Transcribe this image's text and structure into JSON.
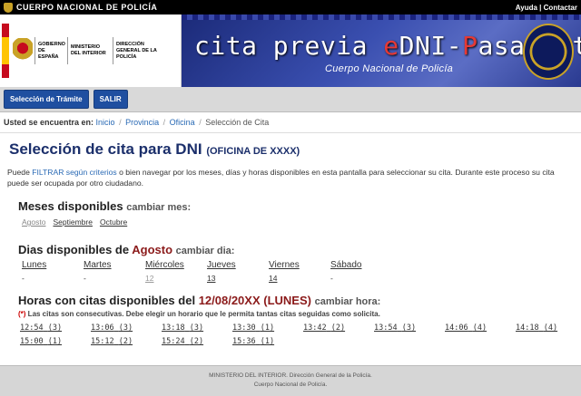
{
  "topbar": {
    "brand": "CUERPO NACIONAL DE POLICÍA",
    "help": "Ayuda",
    "separator": "|",
    "contact": "Contactar"
  },
  "banner": {
    "gov_block1": "GOBIERNO DE ESPAÑA",
    "gov_block2": "MINISTERIO DEL INTERIOR",
    "gov_block3": "DIRECCIÓN GENERAL DE LA POLICÍA",
    "title_part1": "cita previa ",
    "title_e": "e",
    "title_part2": "DNI-",
    "title_p": "P",
    "title_part3": "asaporte",
    "subtitle": "Cuerpo Nacional de Policía"
  },
  "buttons": {
    "select_procedure": "Selección de Trámite",
    "exit": "SALIR"
  },
  "breadcrumb": {
    "prefix": "Usted se encuentra en:",
    "items": [
      "Inicio",
      "Provincia",
      "Oficina"
    ],
    "current": "Selección de Cita"
  },
  "page": {
    "title": "Selección de cita para DNI",
    "office": "(OFICINA DE XXXX)",
    "intro_prefix": "Puede ",
    "intro_filter": "FILTRAR según criterios",
    "intro_rest": " o bien navegar por los meses, días y horas disponibles en esta pantalla para seleccionar su cita. Durante este proceso su cita puede ser ocupada por otro ciudadano."
  },
  "months": {
    "heading": "Meses disponibles",
    "change": "cambiar mes:",
    "items": [
      {
        "label": "Agosto"
      },
      {
        "label": "Septiembre"
      },
      {
        "label": "Octubre"
      }
    ]
  },
  "days": {
    "heading": "Dias disponibles de",
    "month": "Agosto",
    "change": "cambiar dia:",
    "columns": [
      {
        "name": "Lunes",
        "value": "-"
      },
      {
        "name": "Martes",
        "value": "-"
      },
      {
        "name": "Miércoles",
        "value": "12"
      },
      {
        "name": "Jueves",
        "value": "13"
      },
      {
        "name": "Viernes",
        "value": "14"
      },
      {
        "name": "Sábado",
        "value": "-"
      }
    ]
  },
  "hours": {
    "heading": "Horas con citas disponibles del",
    "date": "12/08/20XX (LUNES)",
    "change": "cambiar hora:",
    "note_ast": "(*)",
    "note": " Las citas son consecutivas. Debe elegir un horario que le permita tantas citas seguidas como solicita.",
    "slots": [
      {
        "time": "12:54",
        "count": "(3)"
      },
      {
        "time": "13:06",
        "count": "(3)"
      },
      {
        "time": "13:18",
        "count": "(3)"
      },
      {
        "time": "13:30",
        "count": "(1)"
      },
      {
        "time": "13:42",
        "count": "(2)"
      },
      {
        "time": "13:54",
        "count": "(3)"
      },
      {
        "time": "14:06",
        "count": "(4)"
      },
      {
        "time": "14:18",
        "count": "(4)"
      },
      {
        "time": "15:00",
        "count": "(1)"
      },
      {
        "time": "15:12",
        "count": "(2)"
      },
      {
        "time": "15:24",
        "count": "(2)"
      },
      {
        "time": "15:36",
        "count": "(1)"
      }
    ]
  },
  "footer": {
    "line1": "MINISTERIO DEL INTERIOR. Dirección General de la Policía.",
    "line2": "Cuerpo Nacional de Policía."
  }
}
